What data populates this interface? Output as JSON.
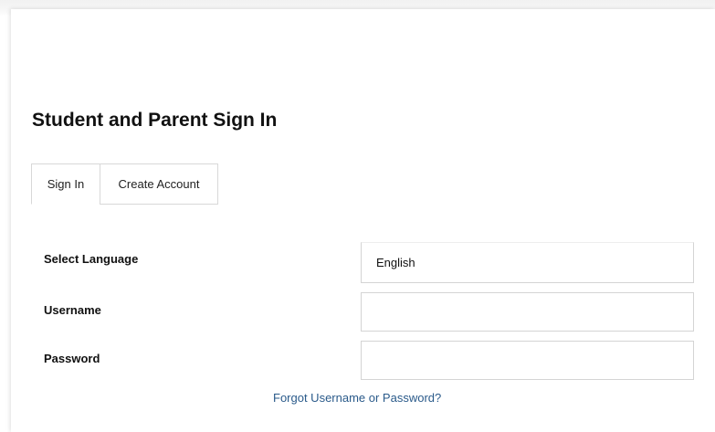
{
  "page": {
    "title": "Student and Parent Sign In"
  },
  "tabs": [
    {
      "label": "Sign In",
      "active": true
    },
    {
      "label": "Create Account",
      "active": false
    }
  ],
  "form": {
    "language_label": "Select Language",
    "language_value": "English",
    "username_label": "Username",
    "username_value": "",
    "password_label": "Password",
    "password_value": ""
  },
  "links": {
    "forgot": "Forgot Username or Password?"
  },
  "colors": {
    "link": "#2a5a8a",
    "border": "#d4d4d4",
    "text": "#111111"
  }
}
